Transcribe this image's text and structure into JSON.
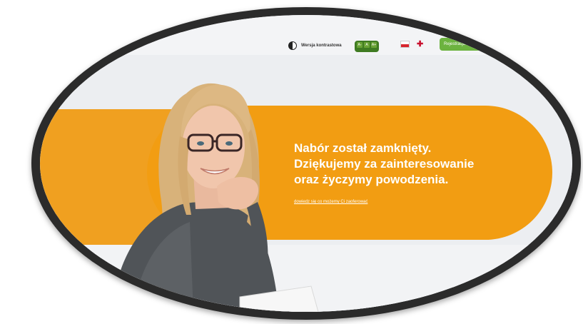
{
  "header": {
    "contrast_label": "Wersja kontrastowa",
    "font_sizes": [
      "A-",
      "A",
      "A+"
    ],
    "languages": [
      "pl",
      "en"
    ],
    "register_label": "Rejestracja"
  },
  "hero": {
    "headline_line1": "Nabór został zamknięty.",
    "headline_line2": "Dziękujemy za zainteresowanie",
    "headline_line3": "oraz życzymy powodzenia.",
    "link_text": "dowiedz się co możemy Ci zaoferować"
  },
  "colors": {
    "banner": "#f29d12",
    "accent_green": "#6cb33f",
    "frame": "#2b2b2b"
  },
  "icons": [
    "contrast-icon",
    "flag-pl-icon",
    "flag-en-icon"
  ]
}
